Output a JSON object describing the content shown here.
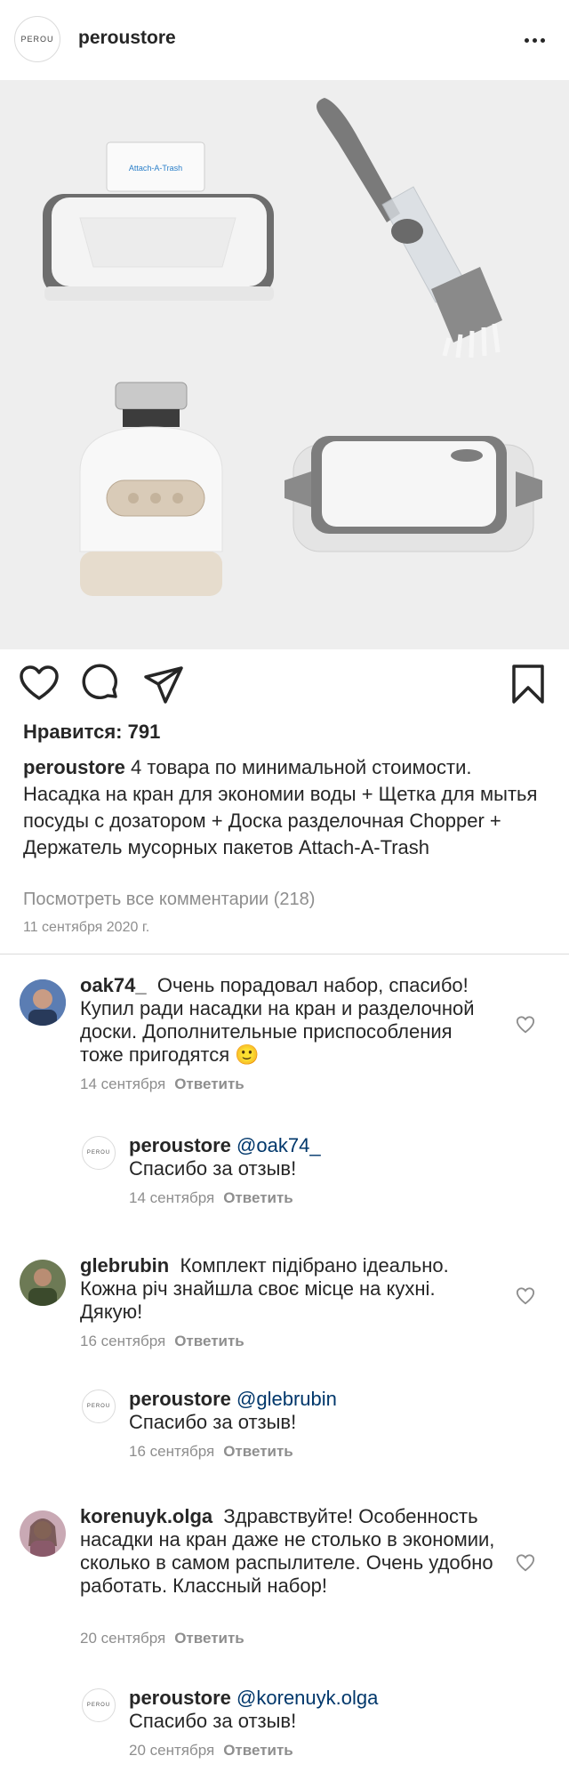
{
  "header": {
    "logo_text": "PEROU",
    "username": "peroustore"
  },
  "post": {
    "likes": "Нравится: 791",
    "caption_user": "peroustore",
    "caption_text": "4 товара по минимальной стоимости. Насадка на кран для экономии воды + Щетка для мытья посуды с дозатором + Доска разделочная Chopper + Держатель мусорных пакетов Attach-A-Trash",
    "product_label": "Attach-A-Trash",
    "view_all": "Посмотреть все комментарии (218)",
    "date": "11 сентября 2020 г."
  },
  "icons": {
    "like": "heart-icon",
    "comment": "comment-icon",
    "share": "share-icon",
    "save": "bookmark-icon",
    "more": "more-icon"
  },
  "reply_label": "Ответить",
  "comments": [
    {
      "user": "oak74_",
      "text": "Очень порадовал набор, спасибо! Купил ради насадки на кран и разделочной доски. Дополнительные приспособления тоже пригодятся 🙂",
      "date": "14 сентября"
    },
    {
      "user": "peroustore",
      "mention": "@oak74_",
      "text": "Спасибо за отзыв!",
      "date": "14 сентября",
      "avatar_text": "PEROU"
    },
    {
      "user": "glebrubin",
      "text": "Комплект підібрано ідеально. Кожна річ знайшла своє місце на кухні. Дякую!",
      "date": "16 сентября"
    },
    {
      "user": "peroustore",
      "mention": "@glebrubin",
      "text": "Спасибо за отзыв!",
      "date": "16 сентября",
      "avatar_text": "PEROU"
    },
    {
      "user": "korenuyk.olga",
      "text": "Здравствуйте! Особенность насадки на кран даже не столько в экономии, сколько в самом распылителе. Очень удобно работать. Классный набор!",
      "date": "20 сентября"
    },
    {
      "user": "peroustore",
      "mention": "@korenuyk.olga",
      "text": "Спасибо за отзыв!",
      "date": "20 сентября",
      "avatar_text": "PEROU"
    }
  ]
}
